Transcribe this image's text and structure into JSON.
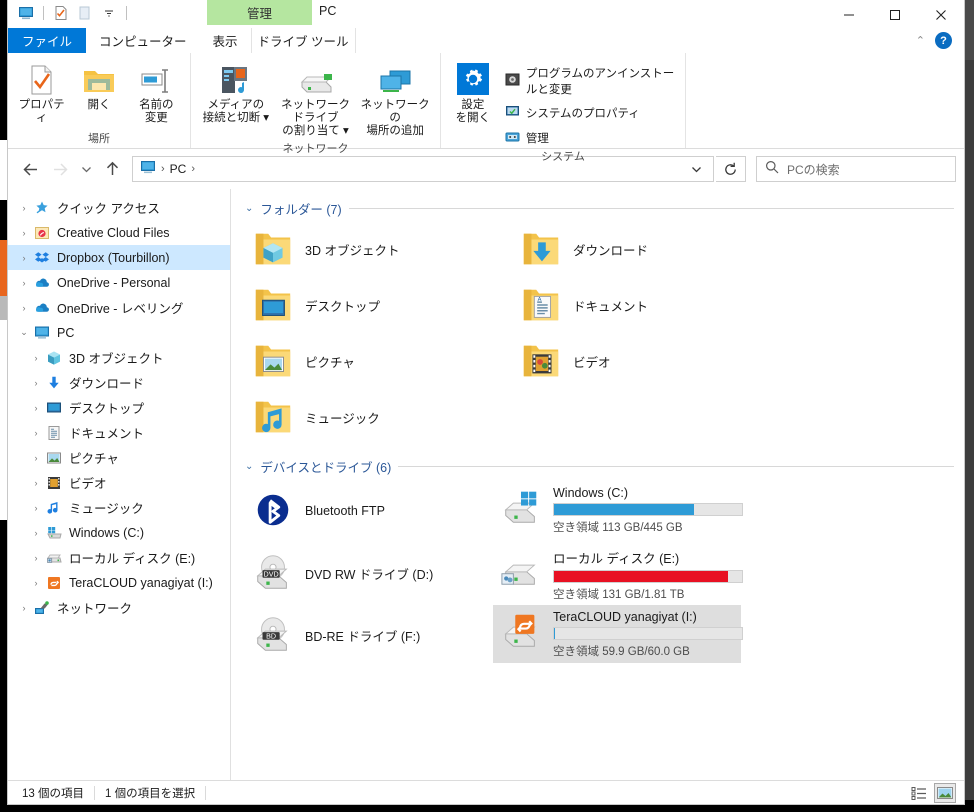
{
  "window": {
    "title": "PC",
    "contextual_tab_title": "管理",
    "contextual_tab_sub": "ドライブ ツール",
    "caption": {
      "minimize": "–",
      "maximize": "□",
      "close": "✕"
    },
    "quick_access": [
      {
        "name": "this-pc-icon"
      },
      {
        "name": "properties-icon"
      },
      {
        "name": "new-folder-icon"
      },
      {
        "name": "customize-dropdown-icon"
      }
    ]
  },
  "ribbon": {
    "tabs": [
      {
        "id": "file",
        "label": "ファイル"
      },
      {
        "id": "computer",
        "label": "コンピューター"
      },
      {
        "id": "view",
        "label": "表示"
      },
      {
        "id": "drive-tools",
        "label": "ドライブ ツール"
      }
    ],
    "collapse_label": "⌃",
    "help_label": "?",
    "groups": [
      {
        "id": "location",
        "label": "場所",
        "big_buttons": [
          {
            "id": "properties",
            "label": "プロパティ",
            "icon": "properties-icon"
          },
          {
            "id": "open",
            "label": "開く",
            "icon": "open-folder-icon"
          },
          {
            "id": "rename",
            "label": "名前の\n変更",
            "line1": "名前の",
            "line2": "変更",
            "icon": "rename-icon"
          }
        ]
      },
      {
        "id": "network",
        "label": "ネットワーク",
        "big_buttons": [
          {
            "id": "media",
            "line1": "メディアの",
            "line2": "接続と切断 ▾",
            "icon": "media-server-icon"
          },
          {
            "id": "map-drive",
            "line1": "ネットワーク ドライブ",
            "line2": "の割り当て ▾",
            "icon": "map-network-drive-icon"
          },
          {
            "id": "add-net-location",
            "line1": "ネットワークの",
            "line2": "場所の追加",
            "icon": "add-network-location-icon"
          }
        ]
      },
      {
        "id": "system",
        "label": "システム",
        "big_buttons": [
          {
            "id": "open-settings",
            "line1": "設定",
            "line2": "を開く",
            "icon": "settings-gear-icon"
          }
        ],
        "small_buttons": [
          {
            "id": "uninstall",
            "label": "プログラムのアンインストールと変更",
            "icon": "uninstall-program-icon"
          },
          {
            "id": "system-properties",
            "label": "システムのプロパティ",
            "icon": "system-properties-icon"
          },
          {
            "id": "manage",
            "label": "管理",
            "icon": "computer-management-icon"
          }
        ]
      }
    ]
  },
  "navbar": {
    "back": "←",
    "forward": "→",
    "recent": "⌄",
    "up": "↑",
    "breadcrumb": {
      "root_icon": "this-pc-icon",
      "items": [
        "PC"
      ],
      "sep": "›"
    },
    "address_dropdown": "⌄",
    "refresh": "⟳",
    "search": {
      "placeholder": "PCの検索",
      "icon": "search-icon",
      "value": ""
    }
  },
  "nav_pane": {
    "items": [
      {
        "label": "クイック アクセス",
        "icon": "quick-access-star-icon",
        "level": 0,
        "expander": "›",
        "selected": false
      },
      {
        "label": "Creative Cloud Files",
        "icon": "creative-cloud-icon",
        "level": 0,
        "expander": "›",
        "selected": false
      },
      {
        "label": "Dropbox (Tourbillon)",
        "icon": "dropbox-icon",
        "level": 0,
        "expander": "›",
        "selected": true
      },
      {
        "label": "OneDrive - Personal",
        "icon": "onedrive-icon",
        "level": 0,
        "expander": "›",
        "selected": false
      },
      {
        "label": "OneDrive - レベリング",
        "icon": "onedrive-icon",
        "level": 0,
        "expander": "›",
        "selected": false
      },
      {
        "label": "PC",
        "icon": "this-pc-icon",
        "level": 0,
        "expander": "⌄",
        "selected": false
      },
      {
        "label": "3D オブジェクト",
        "icon": "3d-objects-icon",
        "level": 1,
        "expander": "›",
        "selected": false
      },
      {
        "label": "ダウンロード",
        "icon": "downloads-icon",
        "level": 1,
        "expander": "›",
        "selected": false
      },
      {
        "label": "デスクトップ",
        "icon": "desktop-icon",
        "level": 1,
        "expander": "›",
        "selected": false
      },
      {
        "label": "ドキュメント",
        "icon": "documents-icon",
        "level": 1,
        "expander": "›",
        "selected": false
      },
      {
        "label": "ピクチャ",
        "icon": "pictures-icon",
        "level": 1,
        "expander": "›",
        "selected": false
      },
      {
        "label": "ビデオ",
        "icon": "videos-icon",
        "level": 1,
        "expander": "›",
        "selected": false
      },
      {
        "label": "ミュージック",
        "icon": "music-icon",
        "level": 1,
        "expander": "›",
        "selected": false
      },
      {
        "label": "Windows (C:)",
        "icon": "windows-drive-icon",
        "level": 1,
        "expander": "›",
        "selected": false
      },
      {
        "label": "ローカル ディスク (E:)",
        "icon": "local-drive-icon",
        "level": 1,
        "expander": "›",
        "selected": false
      },
      {
        "label": "TeraCLOUD yanagiyat (I:)",
        "icon": "teracloud-drive-icon",
        "level": 1,
        "expander": "›",
        "selected": false
      },
      {
        "label": "ネットワーク",
        "icon": "network-icon",
        "level": 0,
        "expander": "›",
        "selected": false
      }
    ]
  },
  "content": {
    "groups": [
      {
        "id": "folders",
        "title": "フォルダー (7)",
        "chevron": "⌄",
        "items": [
          {
            "name": "3D オブジェクト",
            "icon": "folder-3d-objects-icon"
          },
          {
            "name": "ダウンロード",
            "icon": "folder-downloads-icon"
          },
          {
            "name": "デスクトップ",
            "icon": "folder-desktop-icon"
          },
          {
            "name": "ドキュメント",
            "icon": "folder-documents-icon"
          },
          {
            "name": "ピクチャ",
            "icon": "folder-pictures-icon"
          },
          {
            "name": "ビデオ",
            "icon": "folder-videos-icon"
          },
          {
            "name": "ミュージック",
            "icon": "folder-music-icon"
          }
        ]
      },
      {
        "id": "devices",
        "title": "デバイスとドライブ (6)",
        "chevron": "⌄",
        "items": [
          {
            "name": "Bluetooth FTP",
            "icon": "bluetooth-icon",
            "has_bar": false,
            "selected": false
          },
          {
            "name": "Windows (C:)",
            "icon": "windows-drive-icon",
            "has_bar": true,
            "fill_percent": 74.6,
            "bar_color": "#2e9bd6",
            "free_text": "空き領域 113 GB/445 GB",
            "selected": false
          },
          {
            "name": "DVD RW ドライブ (D:)",
            "icon": "dvd-drive-icon",
            "has_bar": false,
            "selected": false
          },
          {
            "name": "ローカル ディスク (E:)",
            "icon": "local-drive-icon",
            "has_bar": true,
            "fill_percent": 92.8,
            "bar_color": "#e81123",
            "free_text": "空き領域 131 GB/1.81 TB",
            "selected": false
          },
          {
            "name": "BD-RE ドライブ (F:)",
            "icon": "bd-drive-icon",
            "has_bar": false,
            "selected": false
          },
          {
            "name": "TeraCLOUD yanagiyat (I:)",
            "icon": "teracloud-drive-icon",
            "has_bar": true,
            "fill_percent": 0.2,
            "bar_color": "#2e9bd6",
            "free_text": "空き領域 59.9 GB/60.0 GB",
            "selected": true
          }
        ]
      }
    ]
  },
  "statusbar": {
    "item_count": "13 個の項目",
    "selection": "1 個の項目を選択",
    "views": [
      {
        "id": "details-view",
        "icon": "details-view-icon",
        "active": false
      },
      {
        "id": "large-icons-view",
        "icon": "large-icons-view-icon",
        "active": true
      }
    ]
  }
}
